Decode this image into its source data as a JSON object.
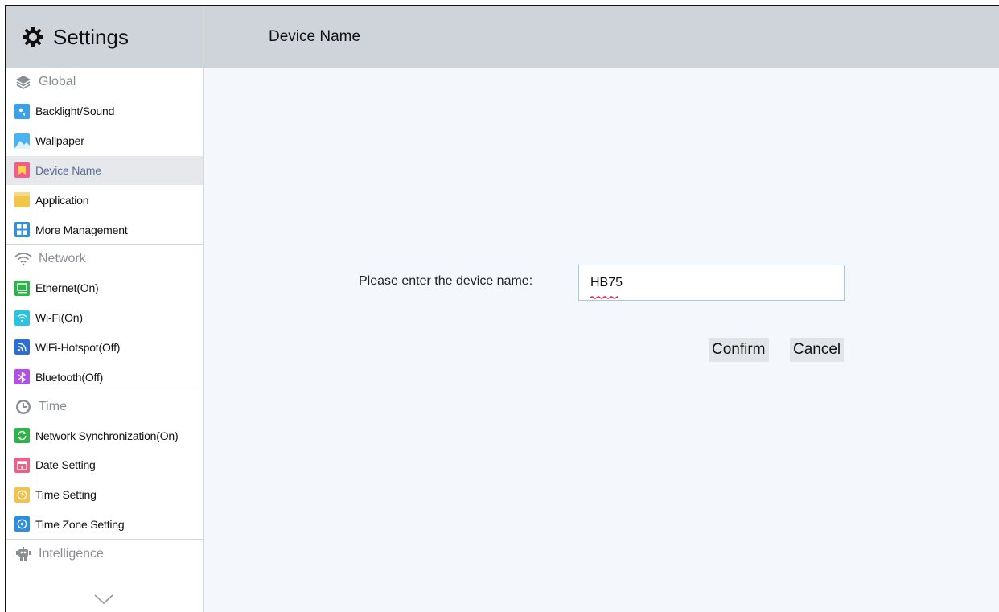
{
  "app": {
    "title": "Settings"
  },
  "main": {
    "title": "Device Name"
  },
  "sidebar": {
    "sections": {
      "global": "Global",
      "network": "Network",
      "time": "Time",
      "intelligence": "Intelligence"
    },
    "items": {
      "backlight": "Backlight/Sound",
      "wallpaper": "Wallpaper",
      "device_name": "Device Name",
      "application": "Application",
      "more_management": "More Management",
      "ethernet": "Ethernet(On)",
      "wifi": "Wi-Fi(On)",
      "hotspot": "WiFi-Hotspot(Off)",
      "bluetooth": "Bluetooth(Off)",
      "net_sync": "Network Synchronization(On)",
      "date_setting": "Date Setting",
      "time_setting": "Time Setting",
      "timezone": "Time Zone Setting"
    }
  },
  "form": {
    "label": "Please enter the device name:",
    "value": "HB75",
    "confirm": "Confirm",
    "cancel": "Cancel"
  },
  "colors": {
    "header_bg": "#cfd4db",
    "main_bg": "#f4f7fb",
    "active_item_bg": "#e6e8ec",
    "active_item_text": "#5a6f95",
    "input_border": "#9fcbe6",
    "button_bg": "#e1e4e8"
  }
}
